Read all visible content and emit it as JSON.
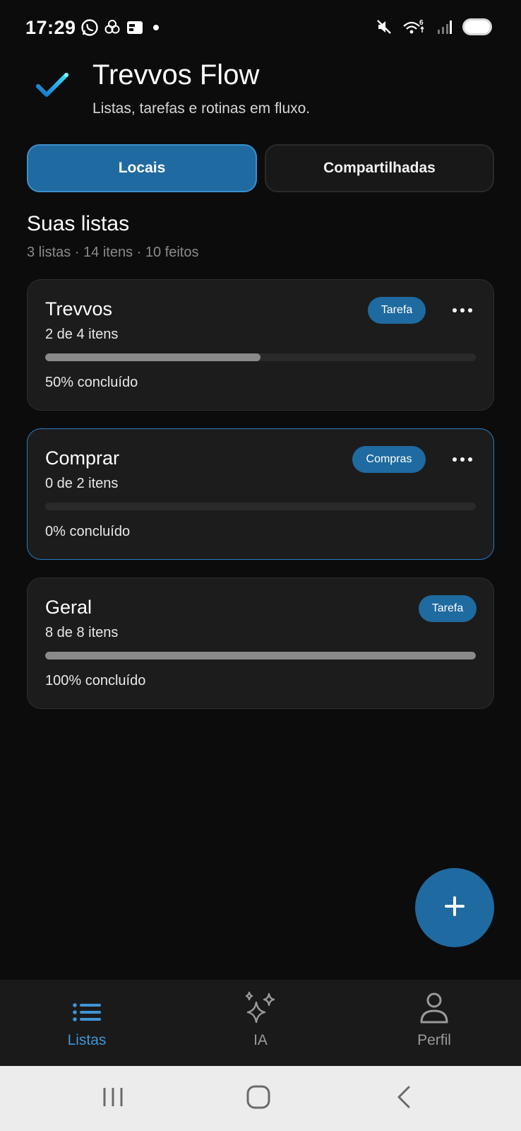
{
  "status_bar": {
    "time": "17:29",
    "notification_icons": [
      "whatsapp-icon",
      "chatgpt-icon",
      "news-icon",
      "dot-icon"
    ],
    "system_icons": [
      "mute-icon",
      "wifi-icon",
      "signal-icon",
      "battery-icon"
    ],
    "wifi_label": "6"
  },
  "header": {
    "title": "Trevvos Flow",
    "subtitle": "Listas, tarefas e rotinas em fluxo."
  },
  "tabs": [
    {
      "label": "Locais",
      "active": true
    },
    {
      "label": "Compartilhadas",
      "active": false
    }
  ],
  "section": {
    "title": "Suas listas",
    "summary": "3 listas · 14 itens · 10 feitos"
  },
  "lists": [
    {
      "title": "Trevvos",
      "count": "2 de 4 itens",
      "badge": "Tarefa",
      "progress": 0.5,
      "percent_label": "50% concluído",
      "has_menu": true,
      "selected": false
    },
    {
      "title": "Comprar",
      "count": "0 de 2 itens",
      "badge": "Compras",
      "progress": 0.0,
      "percent_label": "0% concluído",
      "has_menu": true,
      "selected": true
    },
    {
      "title": "Geral",
      "count": "8 de 8 itens",
      "badge": "Tarefa",
      "progress": 1.0,
      "percent_label": "100% concluído",
      "has_menu": false,
      "selected": false
    }
  ],
  "fab": {
    "icon": "plus-icon"
  },
  "bottom_nav": [
    {
      "label": "Listas",
      "icon": "list-icon",
      "active": true
    },
    {
      "label": "IA",
      "icon": "sparkles-icon",
      "active": false
    },
    {
      "label": "Perfil",
      "icon": "user-icon",
      "active": false
    }
  ],
  "colors": {
    "accent": "#1f6aa0",
    "accent_border": "#3d8fcd",
    "background": "#0c0c0c",
    "card": "#1c1c1c",
    "active_nav": "#3f95d6"
  }
}
